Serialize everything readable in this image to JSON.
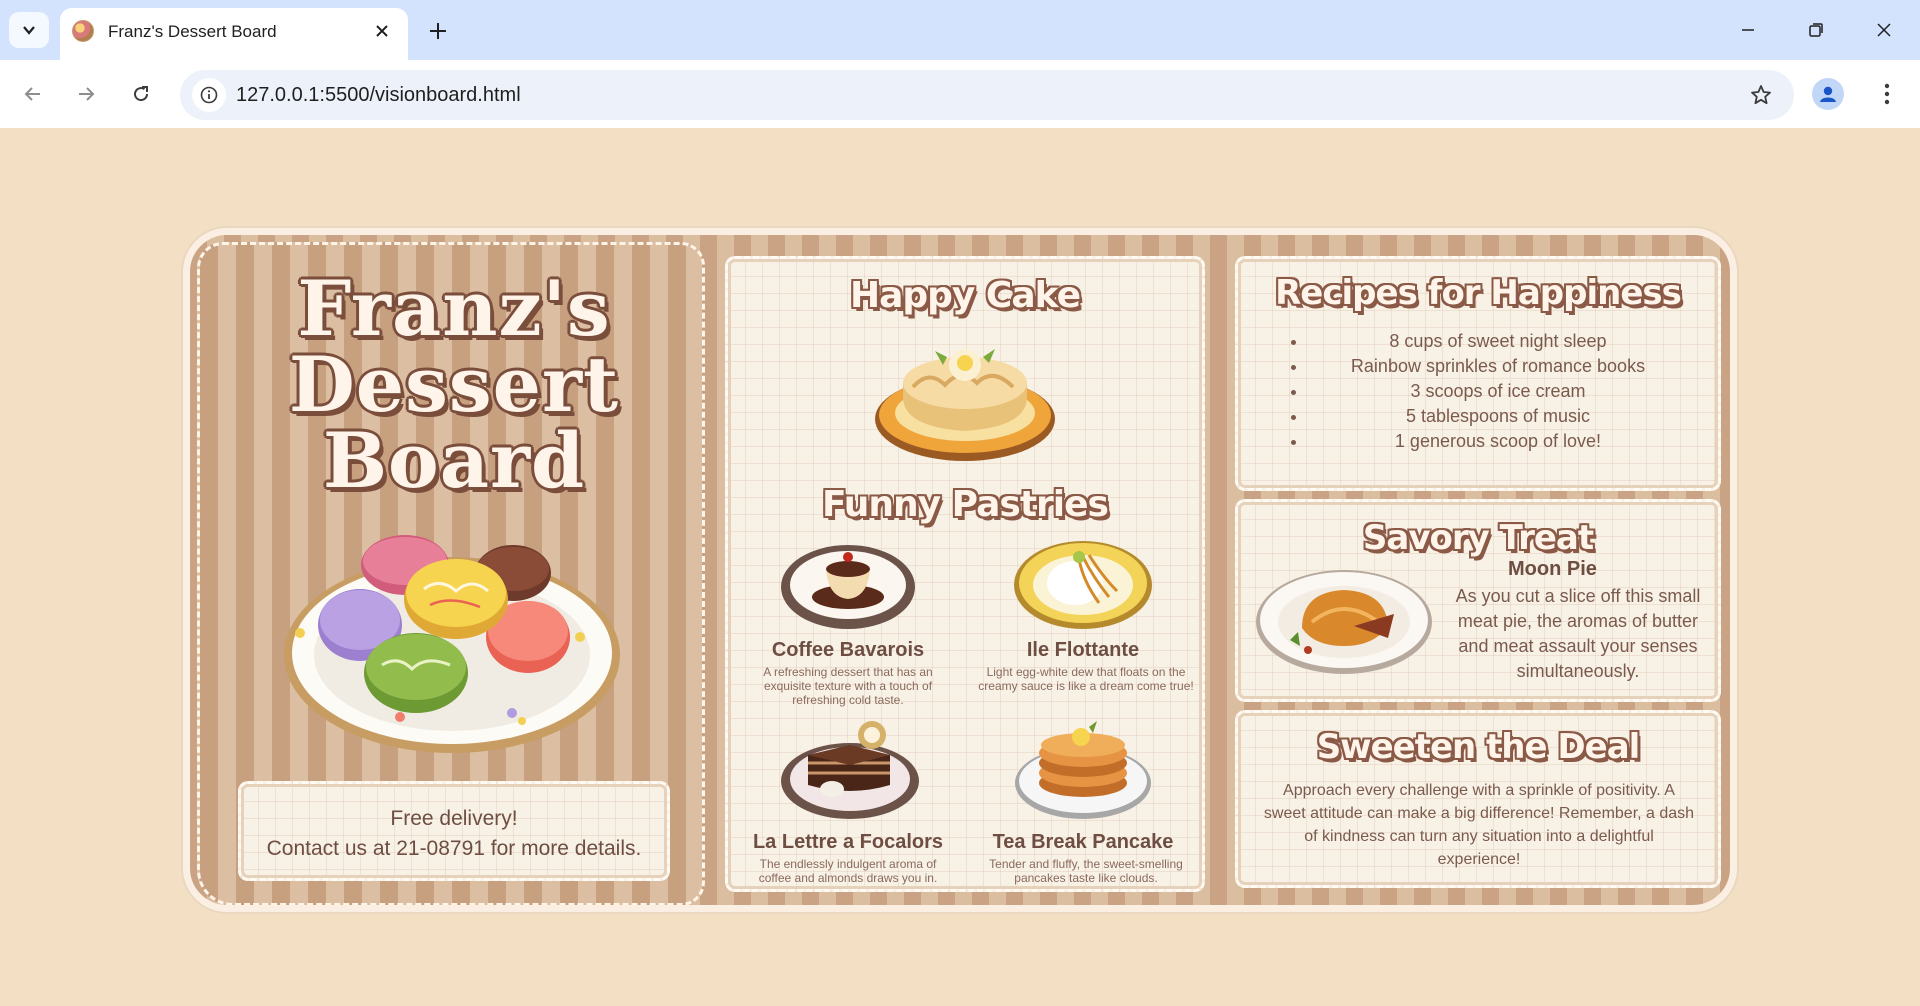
{
  "browser": {
    "tab_title": "Franz's Dessert Board",
    "url": "127.0.0.1:5500/visionboard.html"
  },
  "hero": {
    "title_line1": "Franz's",
    "title_line2": "Dessert",
    "title_line3": "Board",
    "delivery_line1": "Free delivery!",
    "delivery_line2": "Contact us at 21-08791 for more details."
  },
  "happy_cake": {
    "title": "Happy Cake"
  },
  "funny_pastries": {
    "title": "Funny Pastries",
    "items": [
      {
        "name": "Coffee Bavarois",
        "desc": "A refreshing dessert that has an exquisite texture with a touch of refreshing cold taste."
      },
      {
        "name": "Ile Flottante",
        "desc": "Light egg-white dew that floats on the creamy sauce is like a dream come true!"
      },
      {
        "name": "La Lettre a Focalors",
        "desc": "The endlessly indulgent aroma of coffee and almonds draws you in."
      },
      {
        "name": "Tea Break Pancake",
        "desc": "Tender and fluffy, the sweet-smelling pancakes taste like clouds."
      }
    ]
  },
  "recipes": {
    "title": "Recipes for Happiness",
    "items": [
      "8 cups of sweet night sleep",
      "Rainbow sprinkles of romance books",
      "3 scoops of ice cream",
      "5 tablespoons of music",
      "1 generous scoop of love!"
    ]
  },
  "savory": {
    "title": "Savory Treat",
    "dish_name": "Moon Pie",
    "dish_desc": "As you cut a slice off this small meat pie, the aromas of butter and meat assault your senses simultaneously."
  },
  "deal": {
    "title": "Sweeten the Deal",
    "text": "Approach every challenge with a sprinkle of positivity. A sweet attitude can make a big difference! Remember, a dash of kindness can turn any situation into a delightful experience!"
  },
  "colors": {
    "page_bg": "#f3dfc4",
    "stripe_dark": "#c9a383",
    "stripe_light": "#dbbd9f",
    "panel_bg": "#f8f1e6",
    "title_outline": "#8b5a47",
    "text_brown": "#6e4e43"
  }
}
